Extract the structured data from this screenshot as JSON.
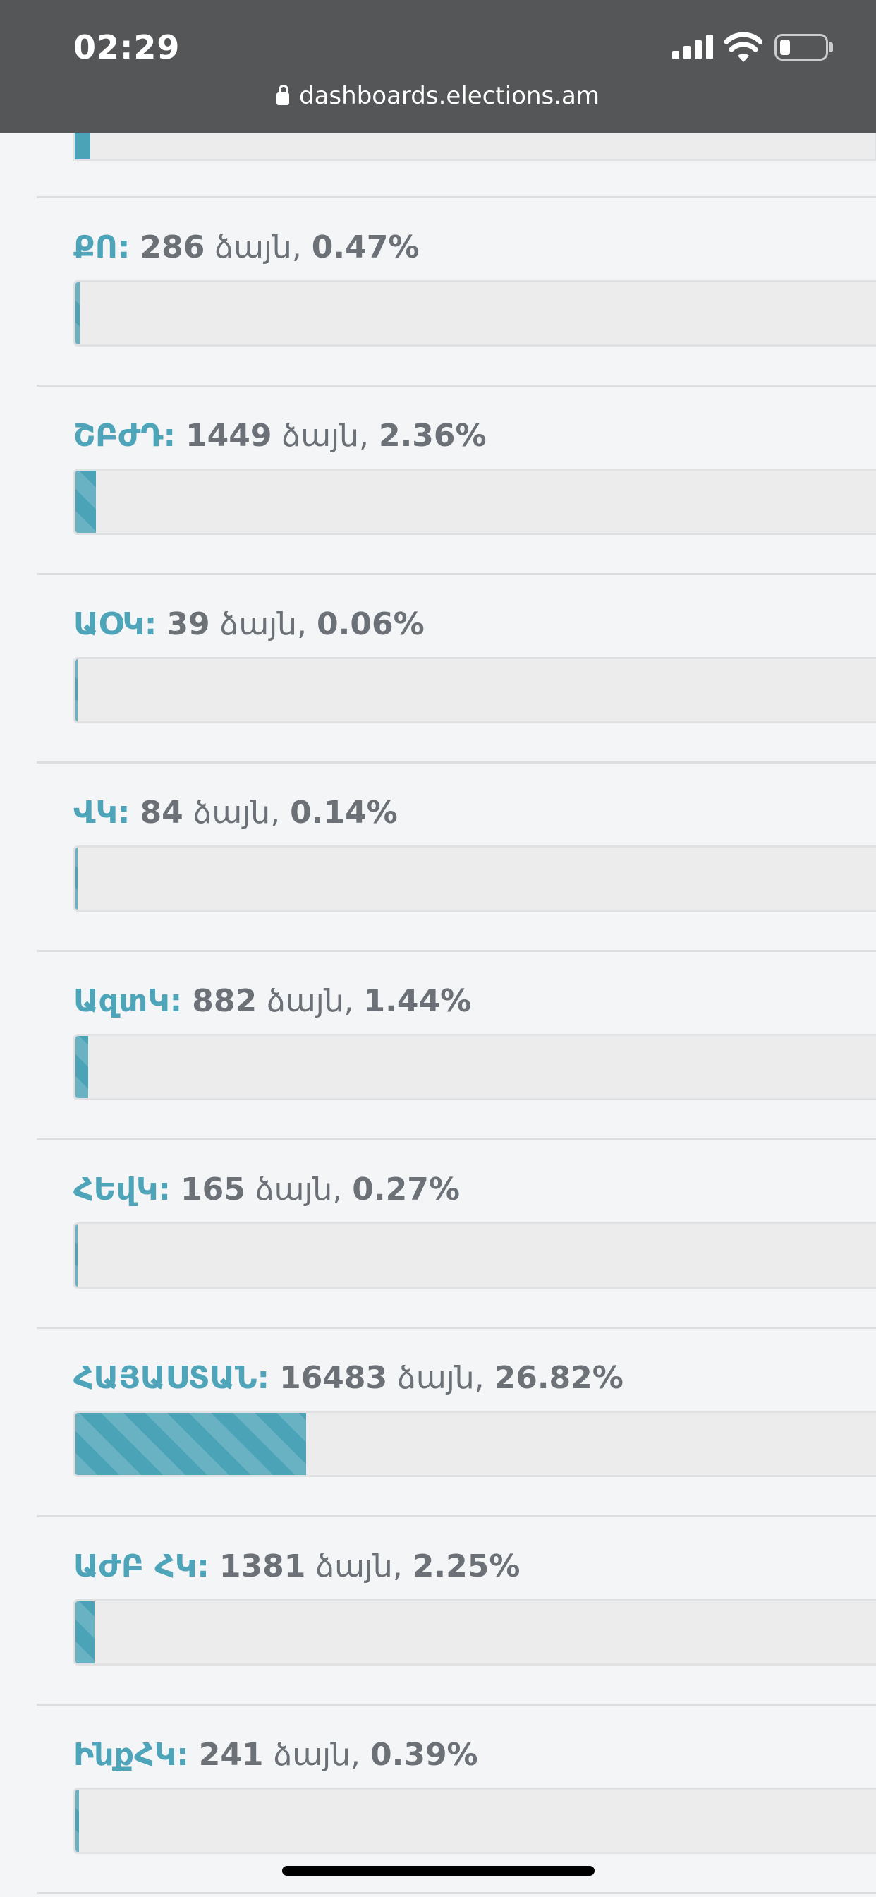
{
  "status_bar": {
    "time": "02:29",
    "url": "dashboards.elections.am"
  },
  "colors": {
    "accent": "#4ea5b9",
    "bar_fill": "#4aa3b7",
    "text_gray": "#6b7177",
    "status_bar_bg": "#555657",
    "page_bg": "#f4f5f6"
  },
  "top_bar_fill_percent": 0.59,
  "parties": [
    {
      "name": "ՔՈ",
      "colon": ":",
      "votes": "286",
      "votes_word": "ձայն,",
      "percent": "0.47%",
      "percent_value": 0.47
    },
    {
      "name": "ՇԲԺԴ",
      "colon": ":",
      "votes": "1449",
      "votes_word": "ձայն,",
      "percent": "2.36%",
      "percent_value": 2.36
    },
    {
      "name": "ԱՕԿ",
      "colon": ":",
      "votes": "39",
      "votes_word": "ձայն,",
      "percent": "0.06%",
      "percent_value": 0.06
    },
    {
      "name": "ՎԿ",
      "colon": ":",
      "votes": "84",
      "votes_word": "ձայն,",
      "percent": "0.14%",
      "percent_value": 0.14
    },
    {
      "name": "ԱզտԿ",
      "colon": ":",
      "votes": "882",
      "votes_word": "ձայն,",
      "percent": "1.44%",
      "percent_value": 1.44
    },
    {
      "name": "ՀԵվԿ",
      "colon": ":",
      "votes": "165",
      "votes_word": "ձայն,",
      "percent": "0.27%",
      "percent_value": 0.27
    },
    {
      "name": "ՀԱՅԱՍՏԱՆ",
      "colon": ":",
      "votes": "16483",
      "votes_word": "ձայն,",
      "percent": "26.82%",
      "percent_value": 26.82
    },
    {
      "name": "ԱԺԲ ՀԿ",
      "colon": ":",
      "votes": "1381",
      "votes_word": "ձայն,",
      "percent": "2.25%",
      "percent_value": 2.25
    },
    {
      "name": "ԻնքՀԿ",
      "colon": ":",
      "votes": "241",
      "votes_word": "ձայն,",
      "percent": "0.39%",
      "percent_value": 0.39
    }
  ]
}
